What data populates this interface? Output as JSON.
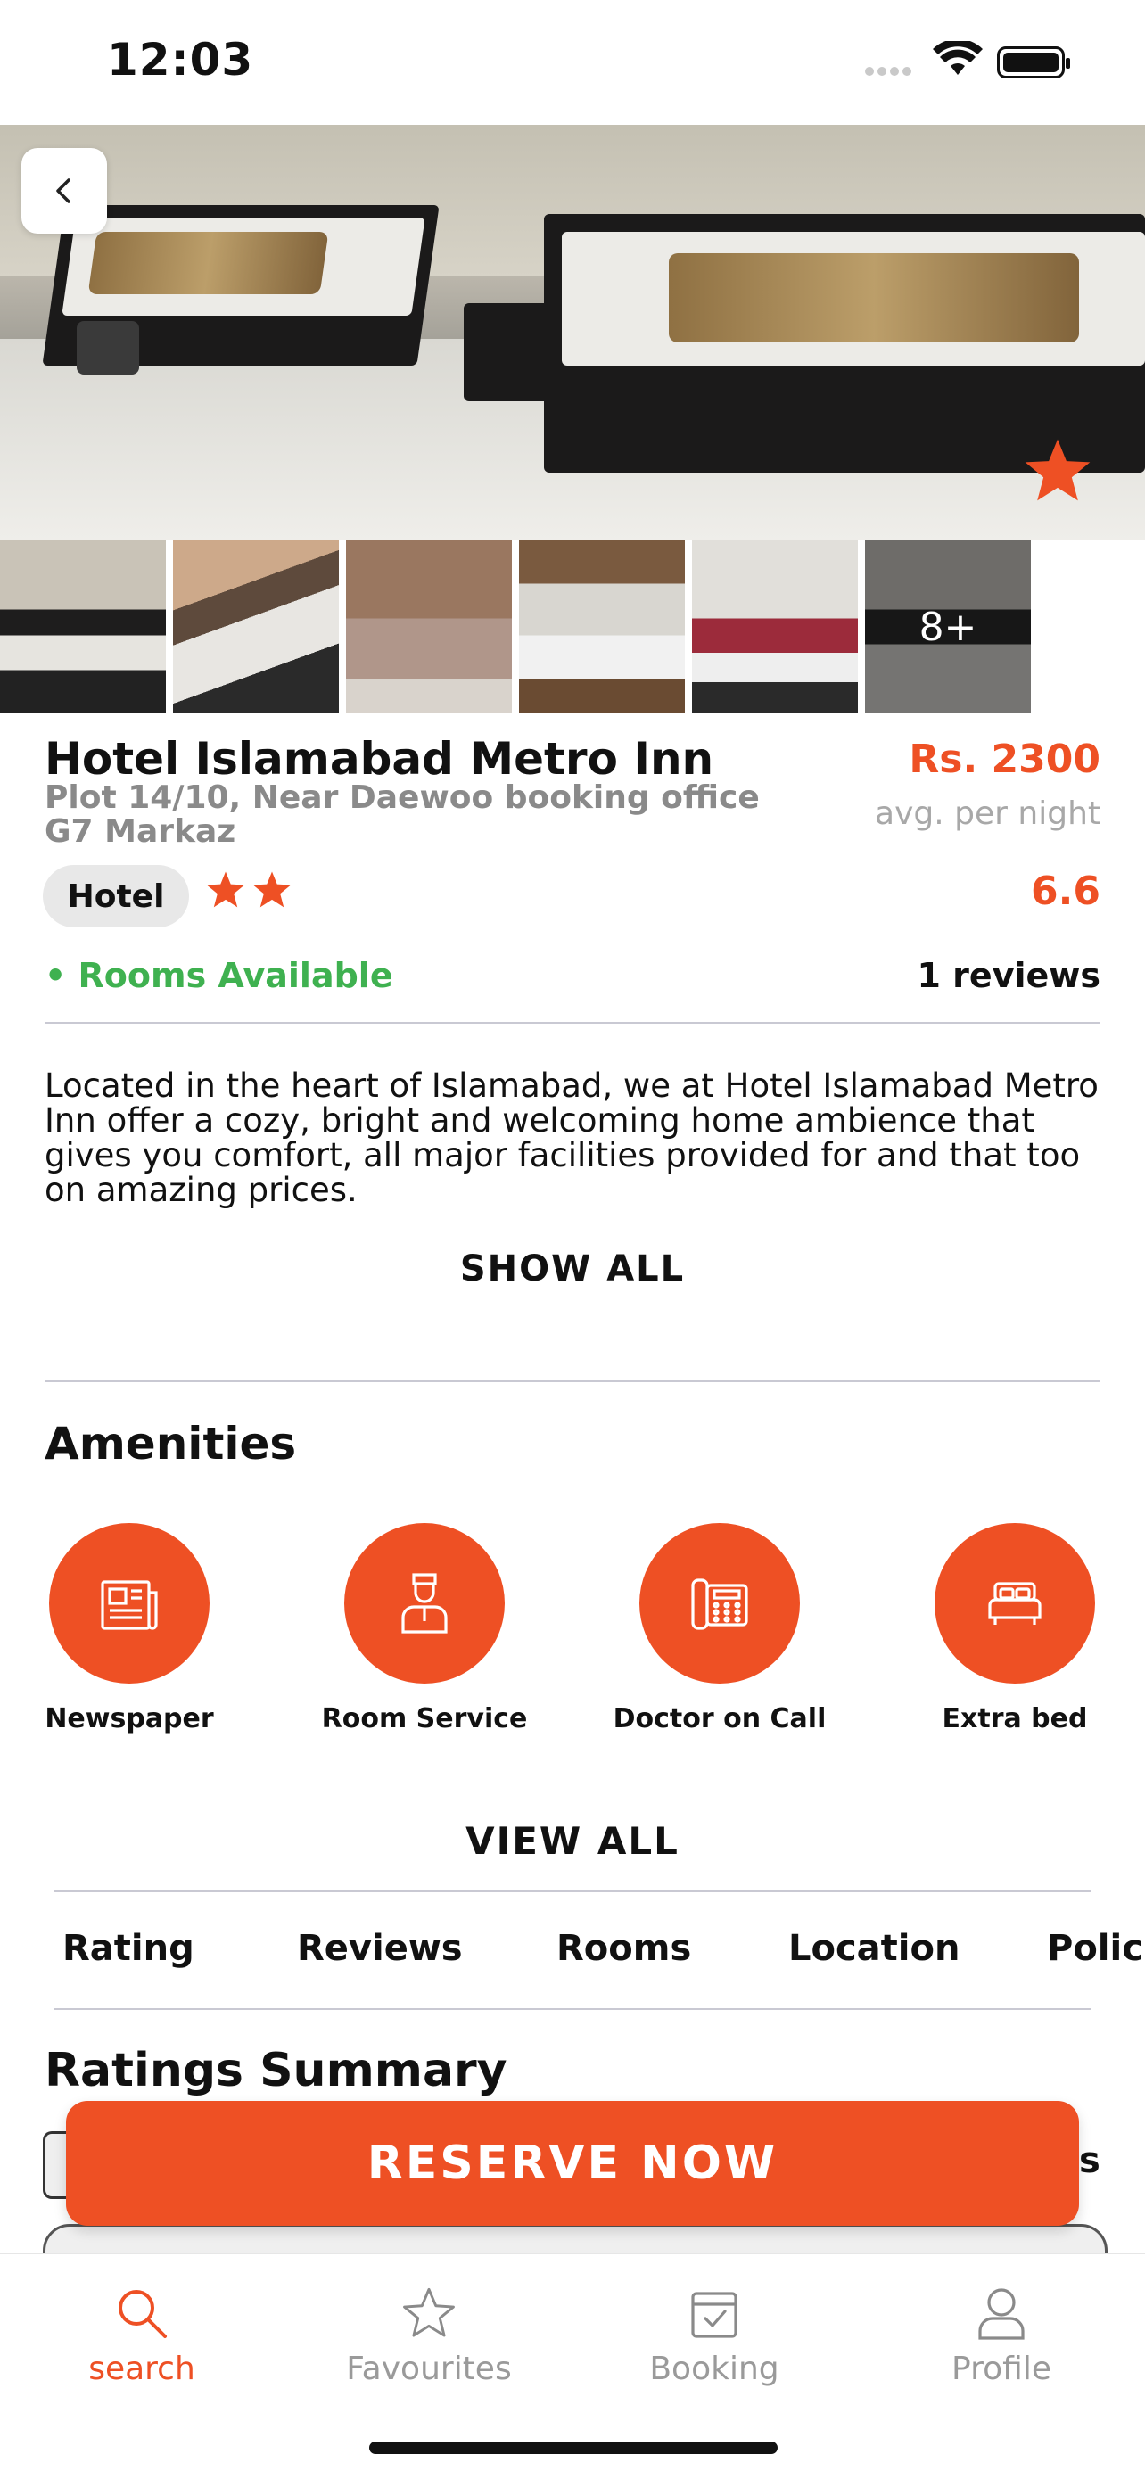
{
  "status": {
    "time": "12:03"
  },
  "hero": {
    "back_icon": "chevron-left-icon",
    "favorite_icon": "star-icon"
  },
  "gallery": {
    "more_label": "8+"
  },
  "hotel": {
    "name": "Hotel Islamabad Metro Inn",
    "address": "Plot 14/10, Near Daewoo booking office G7 Markaz",
    "price": "Rs. 2300",
    "price_note": "avg. per night",
    "type": "Hotel",
    "star_count": 2,
    "score": "6.6",
    "availability": "• Rooms Available",
    "reviews": "1 reviews",
    "description": "Located in the heart of Islamabad, we at Hotel Islamabad Metro Inn offer a cozy, bright and welcoming home ambience that gives you comfort, all major facilities provided for and that too on amazing prices.",
    "show_all": "SHOW ALL"
  },
  "amenities": {
    "title": "Amenities",
    "items": [
      {
        "label": "Newspaper",
        "icon": "newspaper-icon"
      },
      {
        "label": "Room Service",
        "icon": "room-service-icon"
      },
      {
        "label": "Doctor on Call",
        "icon": "telephone-icon"
      },
      {
        "label": "Extra bed",
        "icon": "bed-icon"
      }
    ],
    "view_all": "VIEW ALL"
  },
  "tabs": [
    "Rating",
    "Reviews",
    "Rooms",
    "Location",
    "Polici"
  ],
  "ratings": {
    "title": "Ratings Summary",
    "partial_right": "s"
  },
  "reserve_label": "RESERVE NOW",
  "nav": [
    {
      "label": "search",
      "icon": "search-icon",
      "active": true
    },
    {
      "label": "Favourites",
      "icon": "star-outline-icon",
      "active": false
    },
    {
      "label": "Booking",
      "icon": "calendar-check-icon",
      "active": false
    },
    {
      "label": "Profile",
      "icon": "user-icon",
      "active": false
    }
  ],
  "colors": {
    "accent": "#ee5024",
    "available": "#3fb150",
    "muted": "#9a9a9a"
  }
}
